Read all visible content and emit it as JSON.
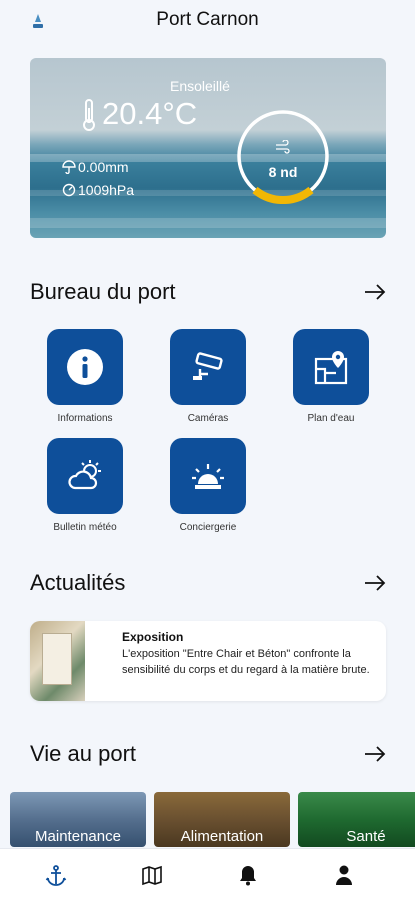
{
  "header": {
    "title": "Port Carnon",
    "logo_icon": "port-logo-icon"
  },
  "weather": {
    "condition": "Ensoleillé",
    "temperature": "20.4°C",
    "rain": "0.00mm",
    "pressure": "1009hPa",
    "wind": "8 nd",
    "wind_gauge_fraction": 0.25,
    "colors": {
      "gauge_ring": "#ffffff",
      "gauge_fill": "#f2b705"
    }
  },
  "bureau": {
    "title": "Bureau du port",
    "tiles": [
      {
        "label": "Informations",
        "icon": "info-icon"
      },
      {
        "label": "Caméras",
        "icon": "camera-icon"
      },
      {
        "label": "Plan d'eau",
        "icon": "map-pin-icon"
      },
      {
        "label": "Bulletin météo",
        "icon": "cloud-sun-icon"
      },
      {
        "label": "Conciergerie",
        "icon": "siren-icon"
      }
    ]
  },
  "actualites": {
    "title": "Actualités",
    "item": {
      "title": "Exposition",
      "text": "L'exposition \"Entre Chair et Béton\" confronte la sensibilité du corps et du regard à la matière brute."
    }
  },
  "vie": {
    "title": "Vie au port",
    "categories": [
      "Maintenance",
      "Alimentation",
      "Santé"
    ]
  },
  "nav": {
    "items": [
      "anchor-icon",
      "map-icon",
      "bell-icon",
      "user-icon"
    ],
    "active_color": "#0e4f9a"
  },
  "colors": {
    "tile_bg": "#0e4f9a",
    "background": "#f3f6fb"
  }
}
